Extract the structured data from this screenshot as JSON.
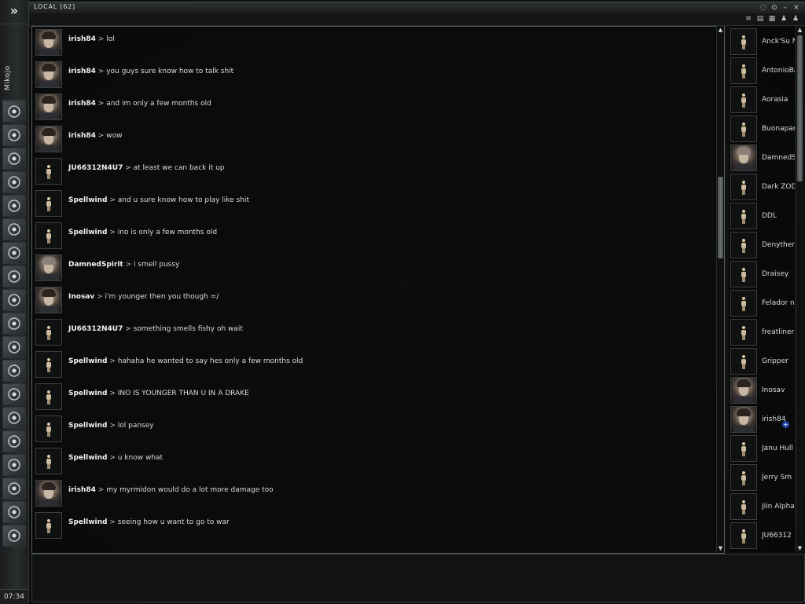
{
  "neocom": {
    "expand_glyph": "»",
    "username": "Mikojo",
    "clock": "07:34",
    "icons": [
      "character-icon",
      "people-search-icon",
      "mail-icon",
      "notepad-icon",
      "assets-icon",
      "market-icon",
      "journal-icon",
      "map-icon",
      "starmap-icon",
      "cargo-icon",
      "science-icon",
      "calculator-icon",
      "help-icon",
      "fleet-icon",
      "browser-icon",
      "log-icon",
      "music-icon",
      "info-icon",
      "portrait-icon"
    ]
  },
  "window": {
    "title": "LOCAL [62]",
    "buttons": [
      "◌",
      "⊙",
      "–",
      "×"
    ]
  },
  "toolbar": {
    "icons": [
      "≡",
      "▤",
      "▦",
      "♟",
      "♟"
    ]
  },
  "messages": [
    {
      "name": "irish84",
      "text": "lol",
      "avatar": "photo-dark"
    },
    {
      "name": "irish84",
      "text": "you guys sure know how to talk shit",
      "avatar": "photo-dark"
    },
    {
      "name": "irish84",
      "text": "and im only a few months old",
      "avatar": "photo-dark"
    },
    {
      "name": "irish84",
      "text": "wow",
      "avatar": "photo-dark"
    },
    {
      "name": "JU66312N4U7",
      "text": "at least we can back it up",
      "avatar": "figure"
    },
    {
      "name": "Spellwind",
      "text": "and u sure know how to play like shit",
      "avatar": "figure"
    },
    {
      "name": "Spellwind",
      "text": "ino is only a few months old",
      "avatar": "figure"
    },
    {
      "name": "DamnedSpirit",
      "text": "i smell pussy",
      "avatar": "photo-light"
    },
    {
      "name": "Inosav",
      "text": "i'm younger then you though =/",
      "avatar": "photo-dark"
    },
    {
      "name": "JU66312N4U7",
      "text": "something smells fishy oh wait",
      "avatar": "figure"
    },
    {
      "name": "Spellwind",
      "text": "hahaha he wanted to say hes only a few months old",
      "avatar": "figure"
    },
    {
      "name": "Spellwind",
      "text": "INO IS YOUNGER THAN U IN A DRAKE",
      "avatar": "figure"
    },
    {
      "name": "Spellwind",
      "text": "lol pansey",
      "avatar": "figure"
    },
    {
      "name": "Spellwind",
      "text": "u know what",
      "avatar": "figure"
    },
    {
      "name": "irish84",
      "text": "my myrmidon would do a lot more damage too",
      "avatar": "photo-dark"
    },
    {
      "name": "Spellwind",
      "text": "seeing how u want to go to war",
      "avatar": "figure"
    }
  ],
  "separator": ">",
  "members": [
    {
      "name": "Anck'Su N",
      "avatar": "figure"
    },
    {
      "name": "AntonioBa",
      "avatar": "figure"
    },
    {
      "name": "Aorasia",
      "avatar": "figure"
    },
    {
      "name": "Buonapart",
      "avatar": "figure"
    },
    {
      "name": "DamnedSp",
      "avatar": "photo-light"
    },
    {
      "name": "Dark ZOD",
      "avatar": "figure"
    },
    {
      "name": "DDL",
      "avatar": "figure"
    },
    {
      "name": "Denythen",
      "avatar": "figure"
    },
    {
      "name": "Draisey",
      "avatar": "figure"
    },
    {
      "name": "Felador n",
      "avatar": "figure"
    },
    {
      "name": "freatliner",
      "avatar": "figure"
    },
    {
      "name": "Gripper",
      "avatar": "figure"
    },
    {
      "name": "Inosav",
      "avatar": "photo-dark"
    },
    {
      "name": "irish84",
      "avatar": "photo-dark",
      "badge": "+"
    },
    {
      "name": "Janu Hull",
      "avatar": "figure"
    },
    {
      "name": "Jerry Sm",
      "avatar": "figure"
    },
    {
      "name": "Jiin Alpha",
      "avatar": "figure"
    },
    {
      "name": "JU66312",
      "avatar": "figure"
    }
  ],
  "scroll": {
    "up": "▲",
    "down": "▼"
  }
}
